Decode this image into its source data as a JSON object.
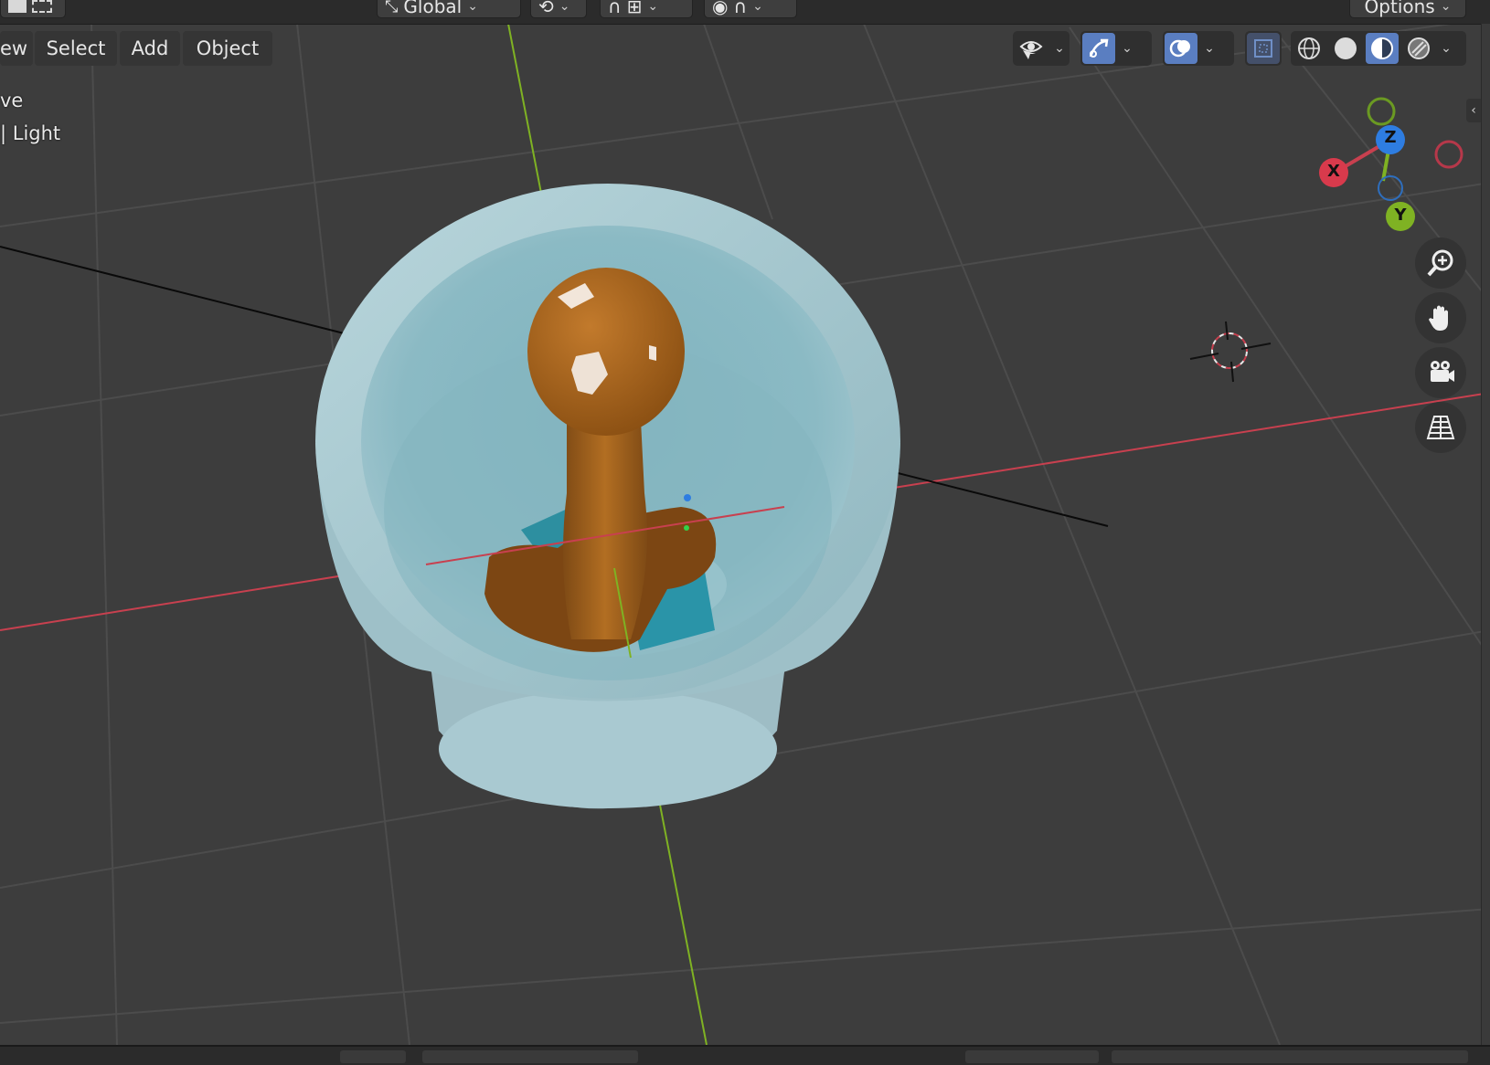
{
  "header": {
    "orientation_label": "Global",
    "options_label": "Options"
  },
  "menu": {
    "view_label": "ew",
    "select_label": "Select",
    "add_label": "Add",
    "object_label": "Object"
  },
  "viewport_info": {
    "line1": "ve",
    "line2": "| Light"
  },
  "gizmo": {
    "x_label": "X",
    "y_label": "Y",
    "z_label": "Z"
  },
  "colors": {
    "background": "#3d3d3d",
    "x_axis": "#c8404f",
    "y_axis": "#7fb223",
    "z_axis": "#2e7de1",
    "active_button": "#5a7ec1",
    "glass": "#9fc3cc",
    "figure": "#9a5a16"
  },
  "icons": {
    "visibility": "eye-icon",
    "gizmo": "transform-gizmo-icon",
    "overlay": "overlay-icon",
    "xray": "xray-icon",
    "wireframe": "wireframe-shading-icon",
    "solid": "solid-shading-icon",
    "material": "material-preview-icon",
    "rendered": "rendered-shading-icon",
    "zoom": "zoom-icon",
    "pan": "hand-icon",
    "camera": "camera-icon",
    "ortho": "perspective-grid-icon"
  }
}
